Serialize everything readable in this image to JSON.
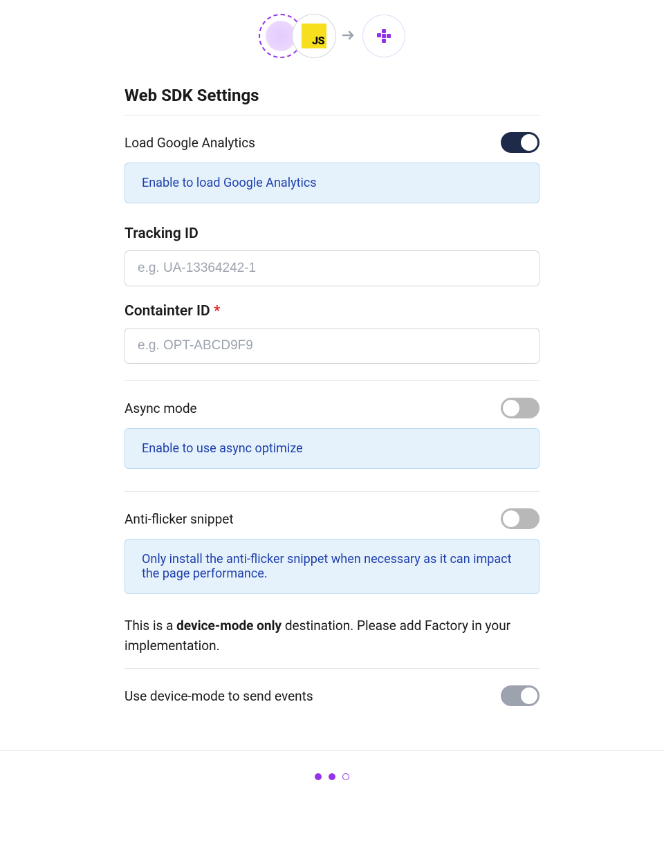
{
  "header": {
    "js_badge": "JS"
  },
  "section": {
    "title": "Web SDK Settings"
  },
  "fields": {
    "load_ga": {
      "label": "Load Google Analytics",
      "info": "Enable to load Google Analytics",
      "enabled": true
    },
    "tracking_id": {
      "label": "Tracking ID",
      "placeholder": "e.g. UA-13364242-1",
      "value": ""
    },
    "container_id": {
      "label": "Containter ID ",
      "required_mark": "*",
      "placeholder": "e.g. OPT-ABCD9F9",
      "value": ""
    },
    "async_mode": {
      "label": "Async mode",
      "info": "Enable to use async optimize",
      "enabled": false
    },
    "anti_flicker": {
      "label": "Anti-flicker snippet",
      "info": "Only install the anti-flicker snippet when necessary as it can impact the page performance.",
      "enabled": false
    },
    "device_mode_note": {
      "prefix": "This is a ",
      "bold": "device-mode only",
      "suffix": " destination. Please add Factory in your implementation."
    },
    "use_device_mode": {
      "label": "Use device-mode to send events",
      "enabled": false
    }
  }
}
